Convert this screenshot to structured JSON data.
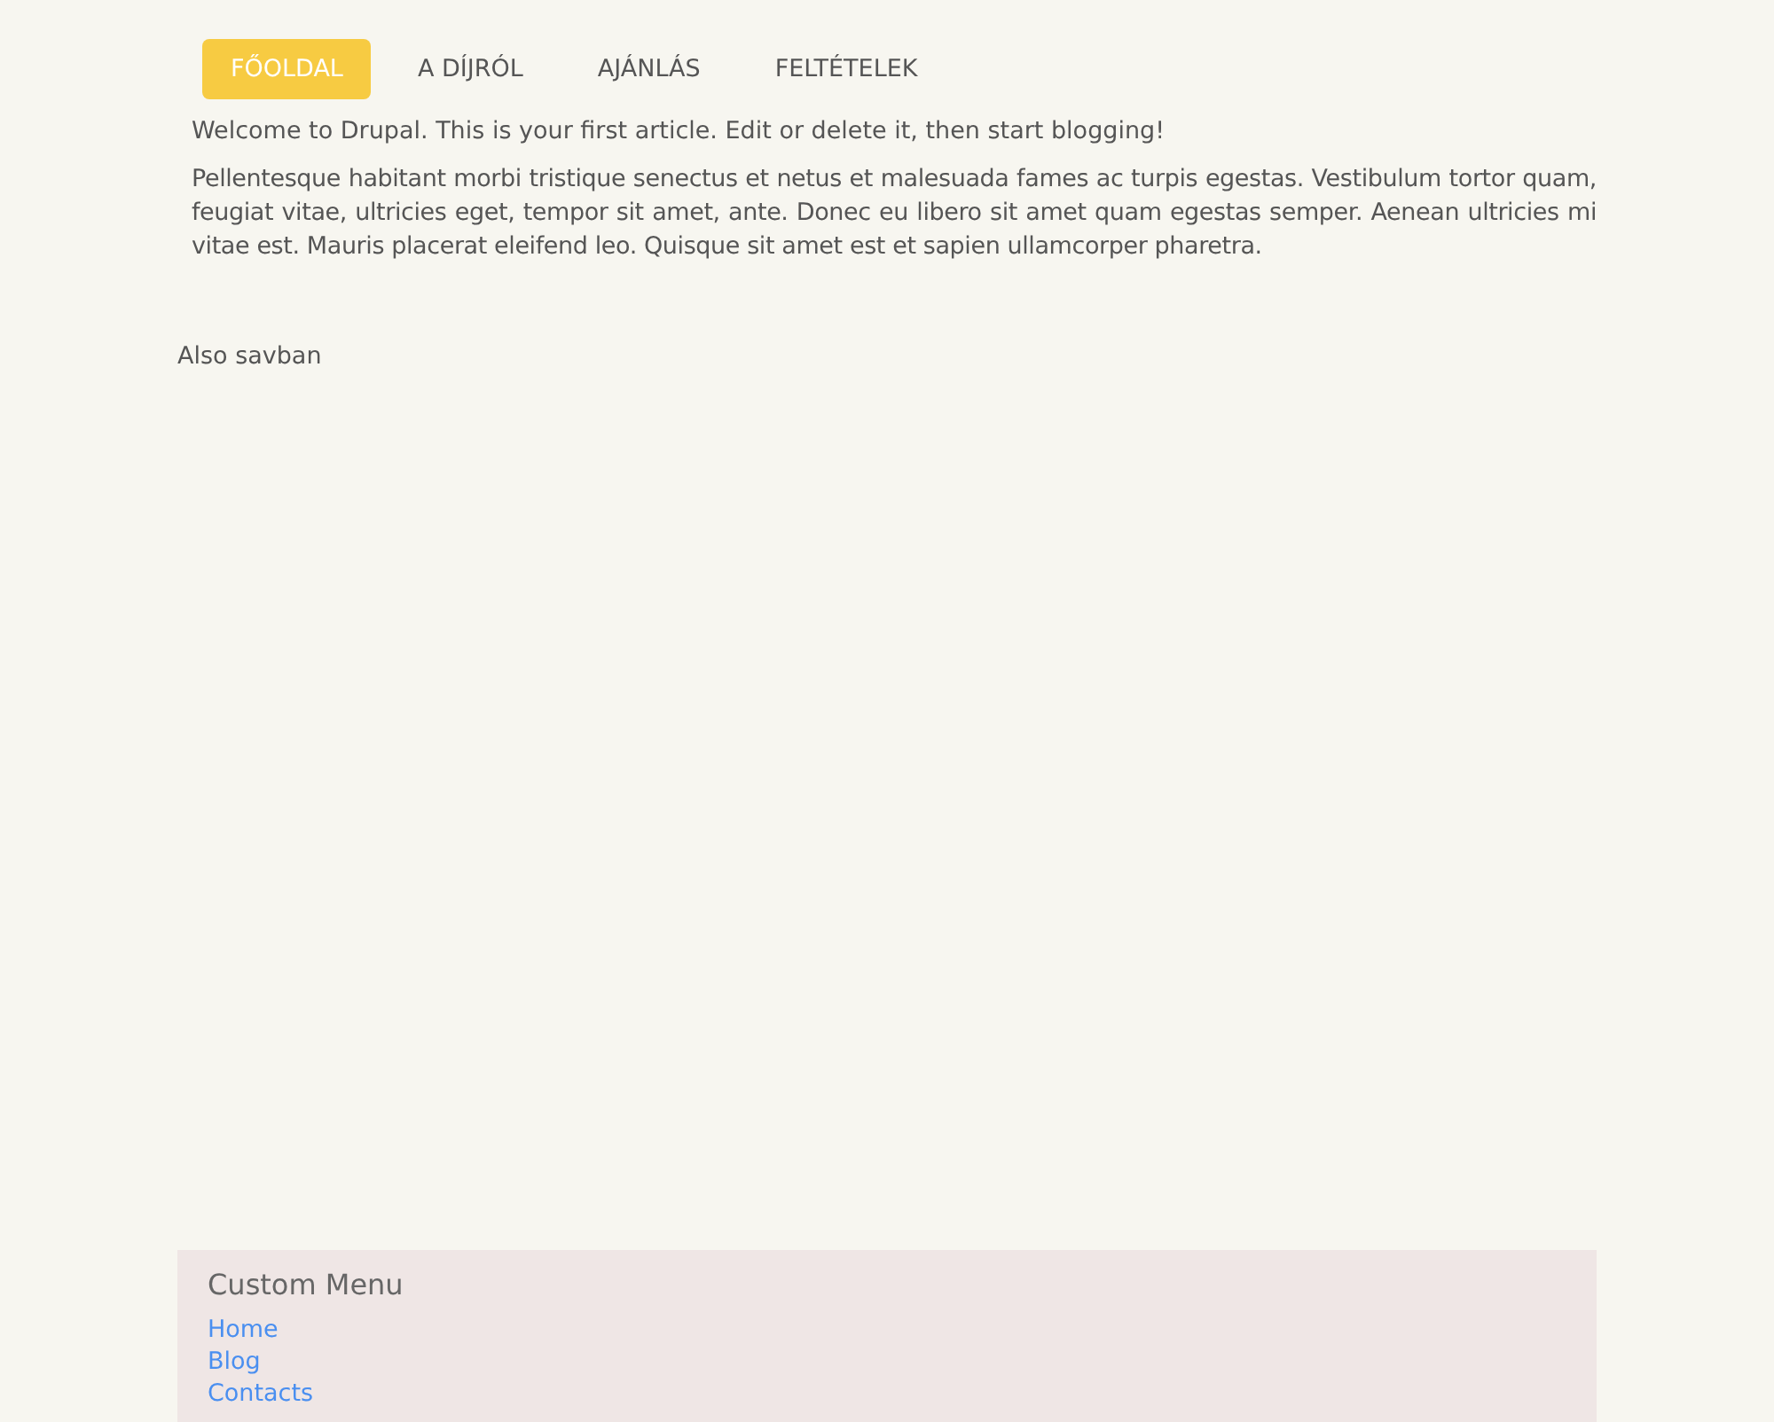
{
  "nav": [
    {
      "label": "FŐOLDAL",
      "selected": true
    },
    {
      "label": "A DÍJRÓL",
      "selected": false
    },
    {
      "label": "AJÁNLÁS",
      "selected": false
    },
    {
      "label": "FELTÉTELEK",
      "selected": false
    }
  ],
  "article": {
    "intro": "Welcome to Drupal. This is your first article. Edit or delete it, then start blogging!",
    "body": "Pellentesque habitant morbi tristique senectus et netus et malesuada fames ac turpis egestas. Vestibulum tortor quam, feugiat vitae, ultricies eget, tempor sit amet, ante. Donec eu libero sit amet quam egestas semper. Aenean ultricies mi vitae est. Mauris placerat eleifend leo. Quisque sit amet est et sapien ullamcorper pharetra."
  },
  "bottom_text": "Also savban",
  "footer": {
    "title": "Custom Menu",
    "links": [
      "Home",
      "Blog",
      "Contacts"
    ]
  }
}
